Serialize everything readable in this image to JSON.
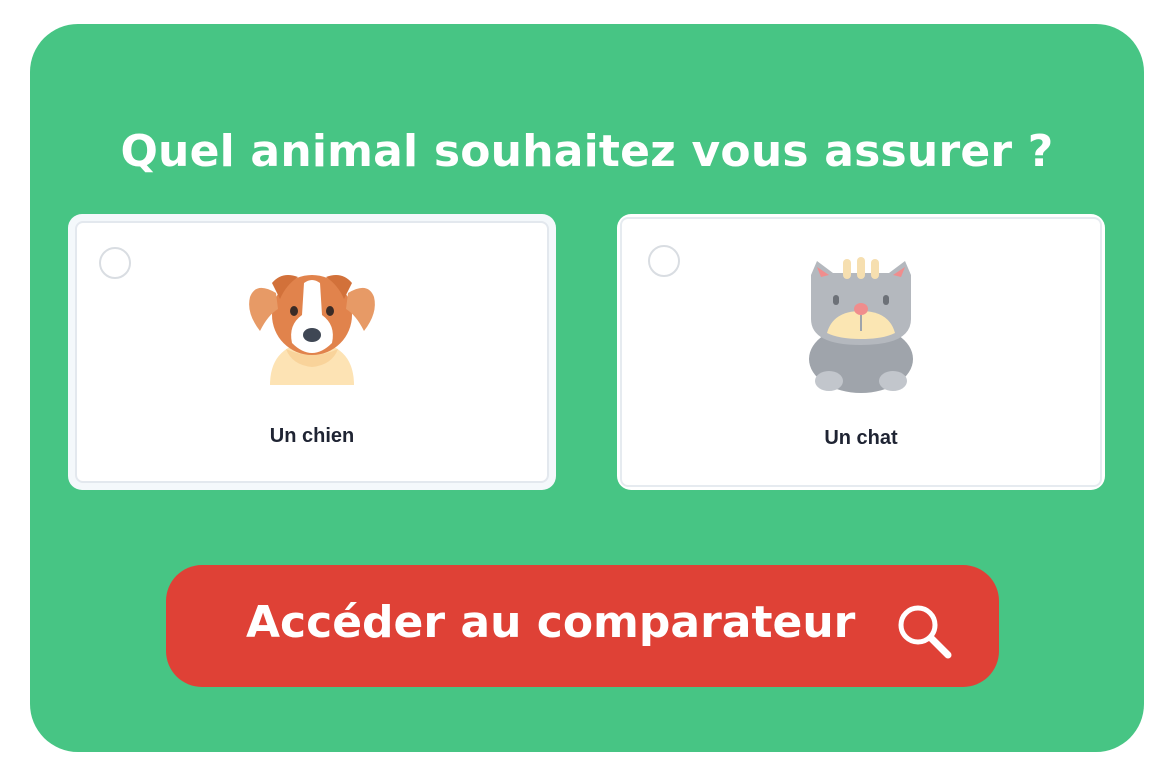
{
  "question": {
    "title": "Quel animal souhaitez vous assurer ?"
  },
  "options": [
    {
      "label": "Un chien",
      "icon": "dog-icon",
      "selected": false
    },
    {
      "label": "Un chat",
      "icon": "cat-icon",
      "selected": false
    }
  ],
  "cta": {
    "label": "Accéder au comparateur",
    "icon": "search-icon"
  },
  "colors": {
    "panel": "#47c584",
    "cta": "#df4136",
    "text_dark": "#1f2433",
    "white": "#ffffff"
  }
}
